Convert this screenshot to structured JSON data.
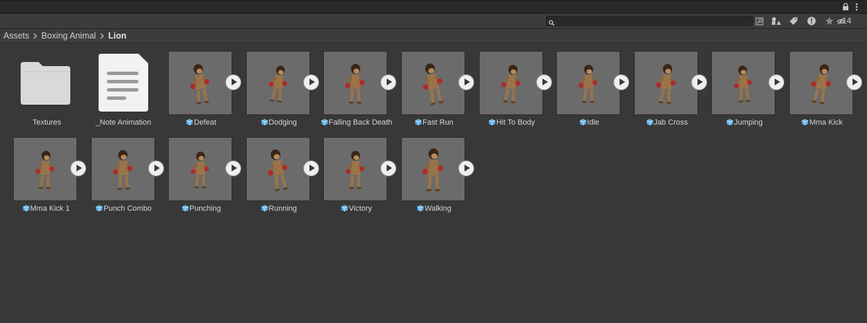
{
  "toolbar": {
    "search_placeholder": "",
    "hidden_count": "14",
    "icons": [
      "lock-icon",
      "more-icon",
      "scene-search-icon",
      "type-filter-icon",
      "label-filter-icon",
      "log-icon",
      "favorite-icon",
      "hidden-packages-icon"
    ]
  },
  "breadcrumb": {
    "items": [
      "Assets",
      "Boxing Animal"
    ],
    "current": "Lion"
  },
  "assets": [
    {
      "name": "Textures",
      "kind": "folder"
    },
    {
      "name": "_Note Animation",
      "kind": "text"
    },
    {
      "name": "Defeat",
      "kind": "model"
    },
    {
      "name": "Dodging",
      "kind": "model"
    },
    {
      "name": "Falling Back Death",
      "kind": "model"
    },
    {
      "name": "Fast Run",
      "kind": "model"
    },
    {
      "name": "Hit To Body",
      "kind": "model"
    },
    {
      "name": "Idle",
      "kind": "model"
    },
    {
      "name": "Jab Cross",
      "kind": "model"
    },
    {
      "name": "Jumping",
      "kind": "model"
    },
    {
      "name": "Mma Kick",
      "kind": "model"
    },
    {
      "name": "Mma Kick 1",
      "kind": "model"
    },
    {
      "name": "Punch Combo",
      "kind": "model"
    },
    {
      "name": "Punching",
      "kind": "model"
    },
    {
      "name": "Running",
      "kind": "model"
    },
    {
      "name": "Victory",
      "kind": "model"
    },
    {
      "name": "Walking",
      "kind": "model"
    }
  ],
  "colors": {
    "cube_icon": "#5bb2e8",
    "thumb_bg": "#6b6b6b",
    "panel_bg": "#383838"
  }
}
